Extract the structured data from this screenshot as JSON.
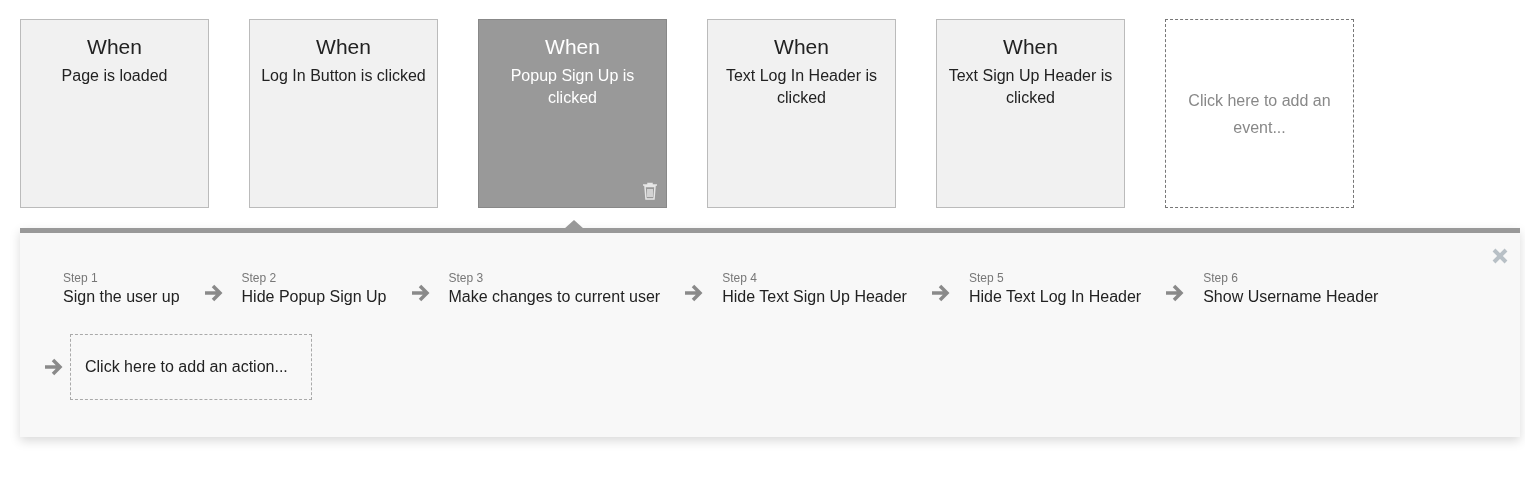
{
  "events": [
    {
      "kind": "event",
      "title": "When",
      "description": "Page is loaded",
      "selected": false
    },
    {
      "kind": "event",
      "title": "When",
      "description": "Log In Button is clicked",
      "selected": false
    },
    {
      "kind": "event",
      "title": "When",
      "description": "Popup Sign Up is clicked",
      "selected": true
    },
    {
      "kind": "event",
      "title": "When",
      "description": "Text Log In Header is clicked",
      "selected": false
    },
    {
      "kind": "event",
      "title": "When",
      "description": "Text Sign Up Header is clicked",
      "selected": false
    },
    {
      "kind": "add",
      "label": "Click here to add an event...",
      "selected": false
    }
  ],
  "steps": [
    {
      "label": "Step 1",
      "action": "Sign the user up"
    },
    {
      "label": "Step 2",
      "action": "Hide Popup Sign Up"
    },
    {
      "label": "Step 3",
      "action": "Make changes to current user"
    },
    {
      "label": "Step 4",
      "action": "Hide Text Sign Up Header"
    },
    {
      "label": "Step 5",
      "action": "Hide Text Log In Header"
    },
    {
      "label": "Step 6",
      "action": "Show Username Header"
    }
  ],
  "add_action": {
    "label": "Click here to add an action..."
  }
}
